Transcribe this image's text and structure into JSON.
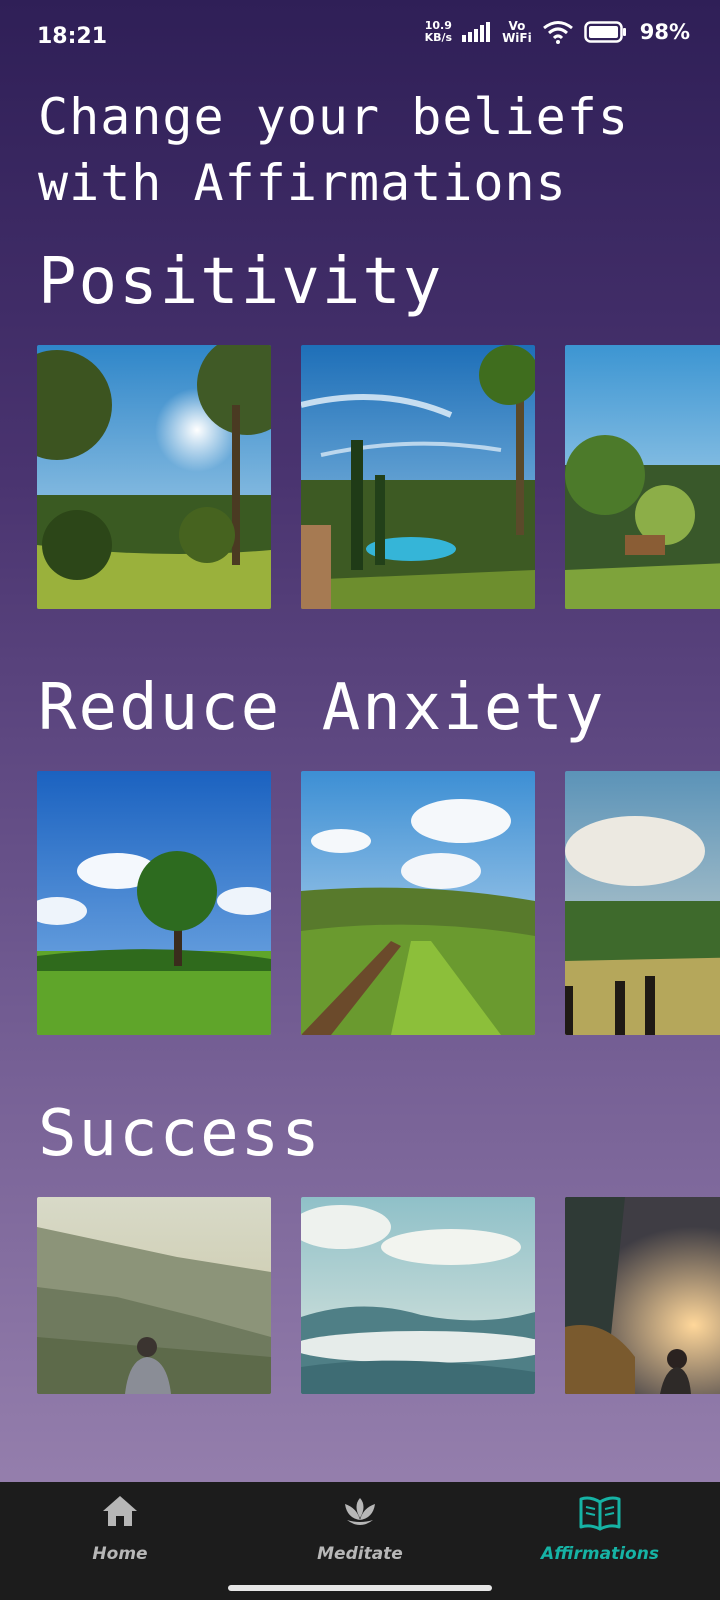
{
  "status_bar": {
    "time": "18:21",
    "net_speed_value": "10.9",
    "net_speed_unit": "KB/s",
    "vo": "Vo",
    "wifi_label": "WiFi",
    "battery_percent": "98%"
  },
  "page_title": "Change your beliefs with Affirmations",
  "sections": [
    {
      "title": "Positivity",
      "images": [
        "sunlit-garden",
        "villa-pool-garden",
        "terrace-garden"
      ]
    },
    {
      "title": "Reduce Anxiety",
      "images": [
        "lone-tree-meadow",
        "green-hills-path",
        "cloudy-pasture"
      ]
    },
    {
      "title": "Success",
      "images": [
        "man-overlooking-mountains",
        "misty-valley",
        "sunset-cliff"
      ]
    }
  ],
  "bottom_nav": {
    "items": [
      {
        "label": "Home",
        "icon": "home-icon",
        "active": false
      },
      {
        "label": "Meditate",
        "icon": "lotus-icon",
        "active": false
      },
      {
        "label": "Affirmations",
        "icon": "open-book-icon",
        "active": true
      }
    ],
    "active_color": "#16b3a5",
    "inactive_color": "#b7b7b7"
  },
  "colors": {
    "background_top": "#2f1f57",
    "background_bottom": "#9d87b3",
    "nav_background": "#1c1c1c"
  }
}
